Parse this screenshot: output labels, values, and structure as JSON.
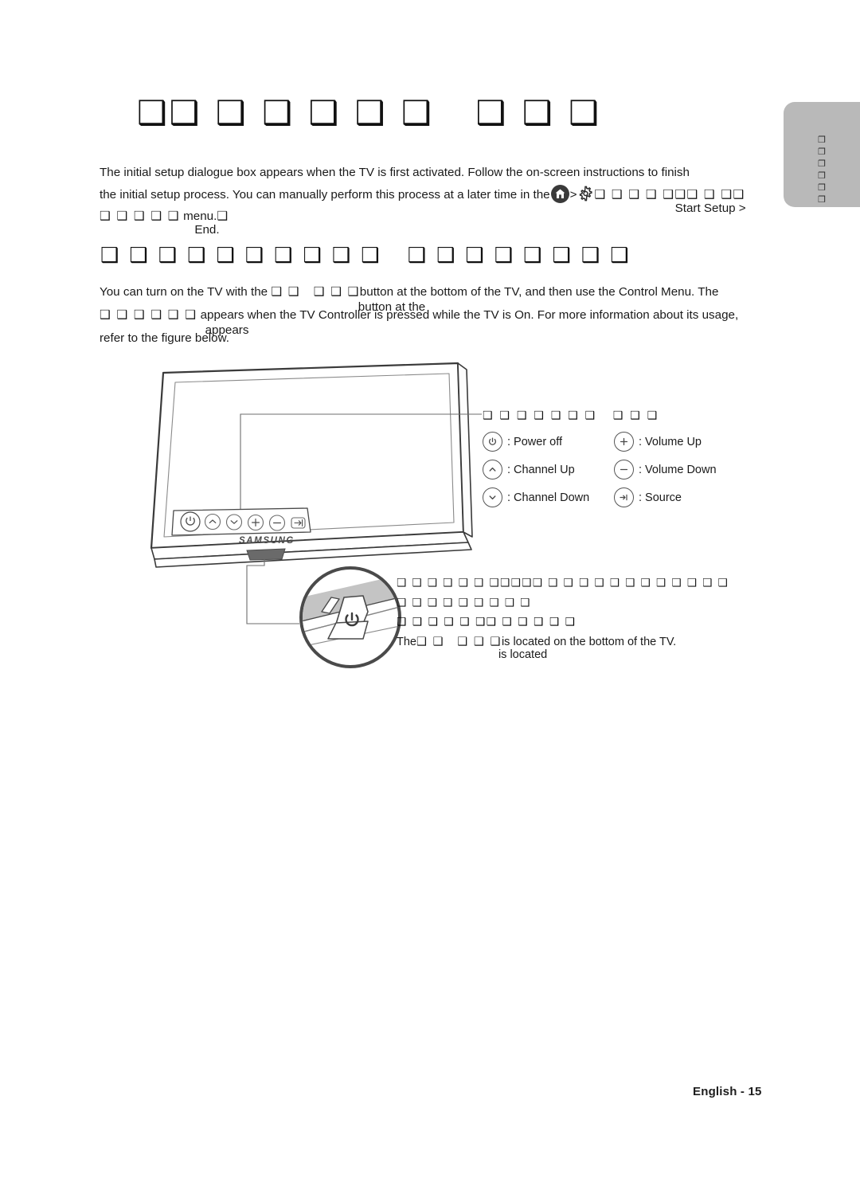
{
  "page": {
    "title_tofu": "❑❑ ❑ ❑ ❑ ❑ ❑   ❑ ❑ ❑",
    "footer": "English - 15"
  },
  "side_tab": {
    "name": "section-tab",
    "glyphs": [
      "❐",
      "❐",
      "❐",
      "❐",
      "❐",
      "❐"
    ]
  },
  "intro": {
    "line1": "The initial setup dialogue box appears when the TV is first activated. Follow the on-screen instructions to finish",
    "line2_a": "the initial setup process. You can manually perform this process at a later time in the",
    "line2_sep": ">",
    "line2_tofu": "❑ ❑ ❑ ❑ ❑❑❑ ❑ ❑❑",
    "line2_overlap": "Start Setup >",
    "line3_tofu": "❑ ❑ ❑ ❑ ❑",
    "line3_text": "menu.",
    "line3_overlap": "End.",
    "line3_tofu_tail": "❑",
    "home_icon": "home-icon",
    "gear_icon": "gear-icon"
  },
  "sub_heading": {
    "tofu": "❑ ❑ ❑ ❑ ❑ ❑ ❑ ❑ ❑ ❑   ❑ ❑ ❑ ❑ ❑ ❑ ❑ ❑"
  },
  "body": {
    "l1_a": "You can turn on the TV with the",
    "l1_tofu1": "❑ ❑",
    "l1_tofu2": "❑ ❑ ❑",
    "l1_overlap": "button at the",
    "l1_b": "button at the bottom of the TV, and then use the Control Menu. The",
    "l2_tofu": "❑ ❑ ❑ ❑ ❑ ❑",
    "l2_overlap": "appears",
    "l2_b": "appears when the TV Controller is pressed while the TV is On. For more information about its usage,",
    "l3": "refer to the figure below."
  },
  "figure": {
    "brand": "SAMSUNG",
    "tv_alt": "samsung-tv-front-illustration",
    "detail_alt": "tv-controller-magnified-detail"
  },
  "legend": {
    "title_tofu": "❑ ❑ ❑ ❑ ❑ ❑ ❑   ❑ ❑ ❑",
    "items": [
      {
        "icon": "power-icon",
        "glyph": "⏻",
        "label": ": Power off"
      },
      {
        "icon": "plus-icon",
        "glyph": "+",
        "label": ": Volume Up"
      },
      {
        "icon": "chevron-up-icon",
        "glyph": "⌃",
        "label": ": Channel Up"
      },
      {
        "icon": "minus-icon",
        "glyph": "−",
        "label": ": Volume Down"
      },
      {
        "icon": "chevron-down-icon",
        "glyph": "⌄",
        "label": ": Channel Down"
      },
      {
        "icon": "source-icon",
        "glyph": "⇥",
        "label": ": Source"
      }
    ]
  },
  "caption": {
    "line1": "❑ ❑   ❑ ❑ ❑ ❑ ❑❑❑❑❑ ❑ ❑ ❑ ❑ ❑ ❑ ❑   ❑ ❑ ❑ ❑ ❑",
    "line2": "❑ ❑ ❑ ❑ ❑   ❑ ❑ ❑ ❑",
    "line3": "❑ ❑ ❑ ❑ ❑ ❑❑ ❑ ❑ ❑ ❑ ❑",
    "line4_a": "The",
    "line4_tofu1": "❑ ❑",
    "line4_tofu2": "❑ ❑ ❑",
    "line4_overlap": "is located",
    "line4_b": "is located on the bottom of the TV."
  },
  "colors": {
    "tab_gray": "#b9b9b9",
    "line_gray": "#555555",
    "text": "#1a1a1a",
    "icon_dark": "#3a3a3a"
  }
}
